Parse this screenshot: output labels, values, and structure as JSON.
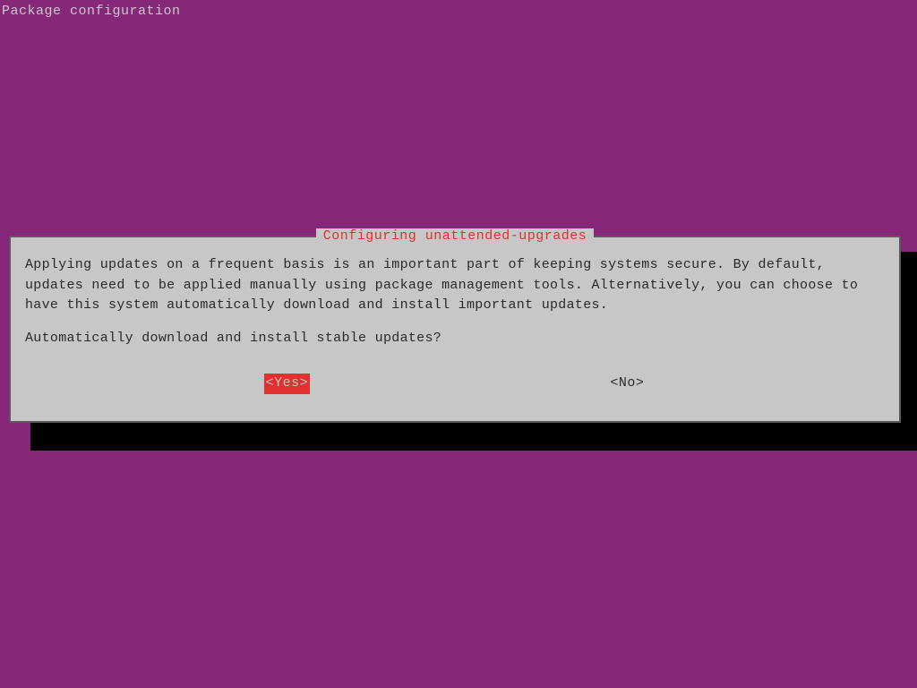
{
  "header": {
    "title": "Package configuration"
  },
  "dialog": {
    "title": "Configuring unattended-upgrades",
    "body": "Applying updates on a frequent basis is an important part of keeping systems secure. By default, updates need to be applied manually using package management tools. Alternatively, you can choose to have this system automatically download and install important updates.",
    "question": "Automatically download and install stable updates?",
    "buttons": {
      "yes": "<Yes>",
      "no": "<No>"
    }
  },
  "colors": {
    "background": "#862779",
    "dialog_bg": "#c7c7c7",
    "dialog_border": "#5a5a5a",
    "accent": "#e03030",
    "text_dark": "#2a2a2a",
    "text_light": "#c8c8c8",
    "shadow": "#000000"
  }
}
